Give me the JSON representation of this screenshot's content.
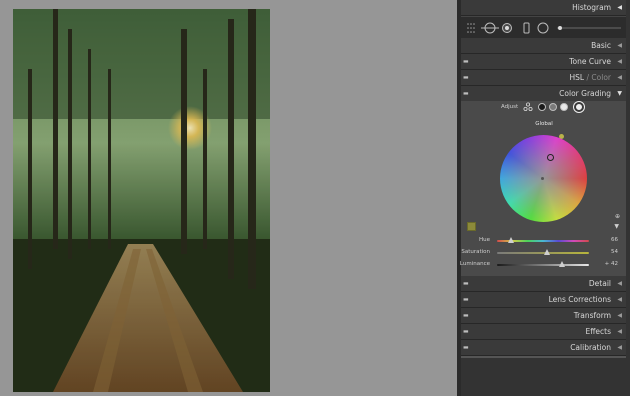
{
  "panels": {
    "histogram": "Histogram",
    "basic": "Basic",
    "tone_curve": "Tone Curve",
    "hsl": "HSL",
    "hsl_sep": "/",
    "color": "Color",
    "color_grading": "Color Grading",
    "detail": "Detail",
    "lens_corrections": "Lens Corrections",
    "transform": "Transform",
    "effects": "Effects",
    "calibration": "Calibration"
  },
  "color_grading": {
    "adjust_label": "Adjust",
    "global_label": "Global",
    "sliders": [
      {
        "label": "Hue",
        "value": "66",
        "fraction": 0.15,
        "gradient": "linear-gradient(to right,#d24a4a,#d2c84a,#4ad25a,#4ab8d2,#5a4ad2,#d24ab8,#d24a4a)"
      },
      {
        "label": "Saturation",
        "value": "54",
        "fraction": 0.54,
        "gradient": "linear-gradient(to right,#7a7a7a,#b7b53c)"
      },
      {
        "label": "Luminance",
        "value": "+ 42",
        "fraction": 0.71,
        "gradient": "linear-gradient(to right,#1a1a1a,#e8e8e8)"
      }
    ]
  },
  "colors": {
    "panel_bg": "#333333",
    "canvas_bg": "#969696",
    "accent_swatch": "#8c8a3a"
  },
  "icons": {
    "collapsed": "triangle-left",
    "expanded": "triangle-down"
  }
}
